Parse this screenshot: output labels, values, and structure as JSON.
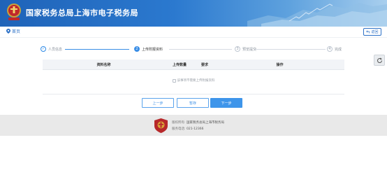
{
  "header": {
    "title": "国家税务总局上海市电子税务局"
  },
  "breadcrumb": {
    "home_label": "首页",
    "back_label": "返回"
  },
  "steps": [
    {
      "num": "✓",
      "label": "人员信息",
      "state": "done"
    },
    {
      "num": "2",
      "label": "上传附报资料",
      "state": "active"
    },
    {
      "num": "3",
      "label": "预览提交",
      "state": "pending"
    },
    {
      "num": "4",
      "label": "完成",
      "state": "pending"
    }
  ],
  "table": {
    "columns": [
      "资料名称",
      "上传数量",
      "要求",
      "操作"
    ],
    "empty_note": "该事项不需要上传附报资料"
  },
  "buttons": {
    "prev": "上一步",
    "save": "暂存",
    "next": "下一步"
  },
  "footer": {
    "copyright_label": "版权所有:",
    "copyright_value": "国家税务总局上海市税务局",
    "phone_label": "服务电话:",
    "phone_value": "021-12366"
  },
  "colors": {
    "accent": "#3a8ee6",
    "header_blue": "#1f63b8",
    "footer_bg": "#e9e9e9"
  }
}
